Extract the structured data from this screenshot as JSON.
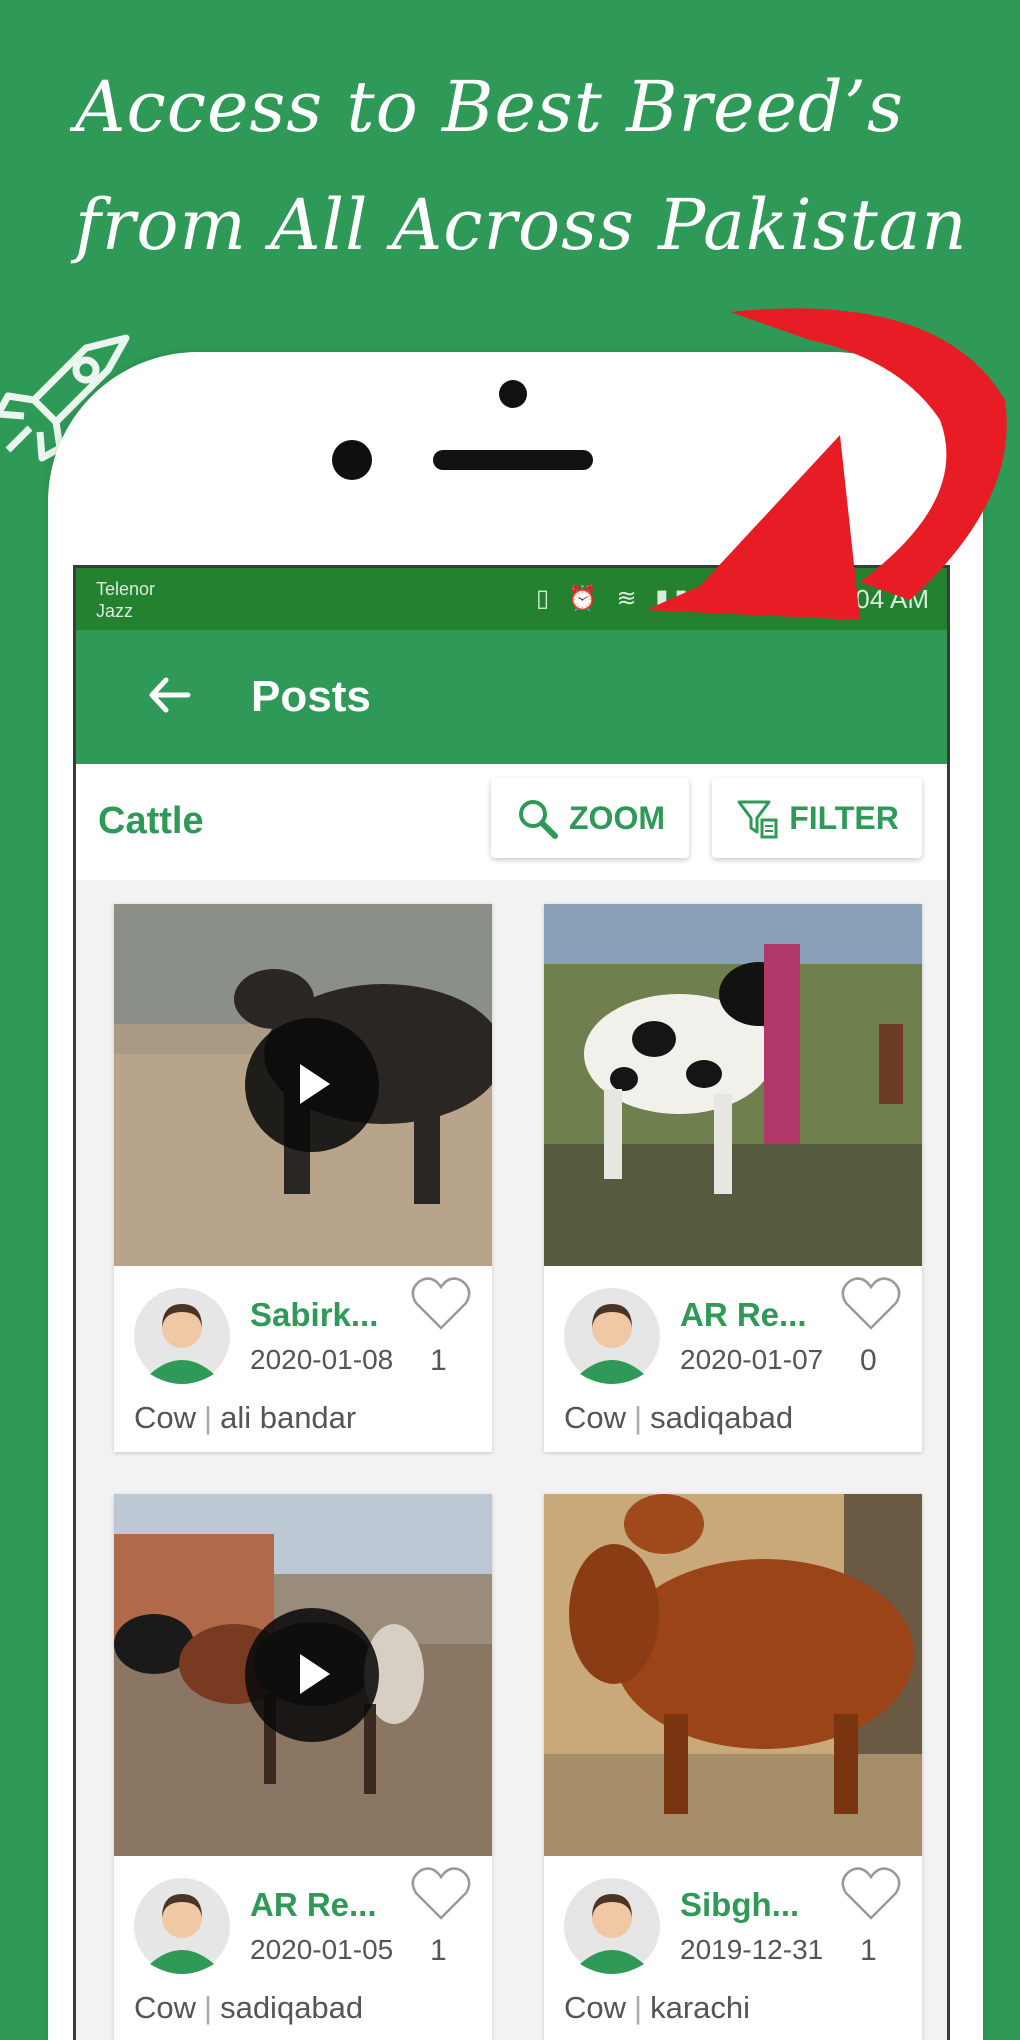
{
  "headline": {
    "line1": "Access to Best Breed’s",
    "line2": "from All Across Pakistan"
  },
  "status_bar": {
    "carrier1": "Telenor",
    "carrier2": "Jazz",
    "time": "0:04 AM"
  },
  "app_bar": {
    "title": "Posts"
  },
  "filter_row": {
    "category": "Cattle",
    "zoom_label": "ZOOM",
    "filter_label": "FILTER"
  },
  "posts": [
    {
      "seller": "Sabirk...",
      "date": "2020-01-08",
      "likes": "1",
      "animal": "Cow",
      "location": "ali bandar",
      "video": true
    },
    {
      "seller": "AR Re...",
      "date": "2020-01-07",
      "likes": "0",
      "animal": "Cow",
      "location": "sadiqabad",
      "video": false
    },
    {
      "seller": "AR Re...",
      "date": "2020-01-05",
      "likes": "1",
      "animal": "Cow",
      "location": "sadiqabad",
      "video": true
    },
    {
      "seller": "Sibgh...",
      "date": "2019-12-31",
      "likes": "1",
      "animal": "Cow",
      "location": "karachi",
      "video": false
    }
  ],
  "colors": {
    "brand_green": "#2f9a57",
    "status_green": "#23812f",
    "arrow_red": "#e81c24"
  }
}
